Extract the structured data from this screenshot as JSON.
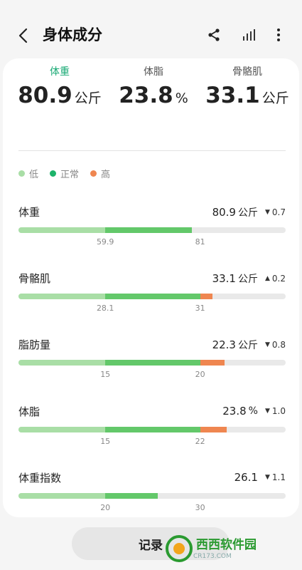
{
  "header": {
    "title": "身体成分"
  },
  "summary": [
    {
      "label": "体重",
      "value": "80.9",
      "unit": "公斤",
      "active": true
    },
    {
      "label": "体脂",
      "value": "23.8",
      "unit": "%",
      "active": false
    },
    {
      "label": "骨骼肌",
      "value": "33.1",
      "unit": "公斤",
      "active": false
    }
  ],
  "legend": {
    "low": "低",
    "normal": "正常",
    "high": "高",
    "colors": {
      "low": "#a9dea6",
      "normal": "#1db36a",
      "high": "#ef8650"
    }
  },
  "metrics": [
    {
      "name": "体重",
      "value": "80.9",
      "unit": "公斤",
      "direction": "down",
      "delta": "0.7",
      "ticks": [
        "59.9",
        "81"
      ],
      "fill": {
        "low_end": 0.325,
        "normal_end": 0.65,
        "high_end": 0.65
      }
    },
    {
      "name": "骨骼肌",
      "value": "33.1",
      "unit": "公斤",
      "direction": "up",
      "delta": "0.2",
      "ticks": [
        "28.1",
        "31"
      ],
      "fill": {
        "low_end": 0.325,
        "normal_end": 0.68,
        "high_end": 0.725
      }
    },
    {
      "name": "脂肪量",
      "value": "22.3",
      "unit": "公斤",
      "direction": "down",
      "delta": "0.8",
      "ticks": [
        "15",
        "20"
      ],
      "fill": {
        "low_end": 0.325,
        "normal_end": 0.68,
        "high_end": 0.77
      }
    },
    {
      "name": "体脂",
      "value": "23.8",
      "unit": "%",
      "direction": "down",
      "delta": "1.0",
      "ticks": [
        "15",
        "22"
      ],
      "fill": {
        "low_end": 0.325,
        "normal_end": 0.68,
        "high_end": 0.78
      }
    },
    {
      "name": "体重指数",
      "value": "26.1",
      "unit": "",
      "direction": "down",
      "delta": "1.1",
      "ticks": [
        "20",
        "30"
      ],
      "fill": {
        "low_end": 0.325,
        "normal_end": 0.52,
        "high_end": 0.52
      }
    }
  ],
  "bottom": {
    "record_label": "记录"
  },
  "watermark": {
    "text": "西西软件园",
    "sub": "CR173.COM"
  }
}
